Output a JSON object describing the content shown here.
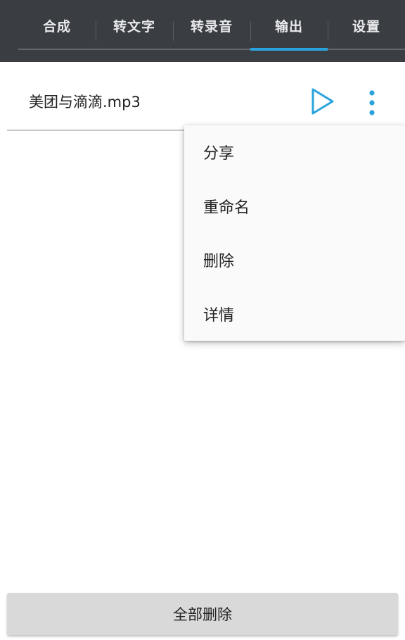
{
  "tabs": [
    {
      "label": "合成"
    },
    {
      "label": "转文字"
    },
    {
      "label": "转录音"
    },
    {
      "label": "输出",
      "active": true
    },
    {
      "label": "设置"
    }
  ],
  "accent_color": "#2aa3dd",
  "files": [
    {
      "name": "美团与滴滴.mp3",
      "icons": [
        "play-icon",
        "more-vertical-icon"
      ]
    }
  ],
  "popup_menu": {
    "items": [
      {
        "label": "分享"
      },
      {
        "label": "重命名"
      },
      {
        "label": "删除"
      },
      {
        "label": "详情"
      }
    ]
  },
  "footer": {
    "delete_all_label": "全部删除"
  }
}
